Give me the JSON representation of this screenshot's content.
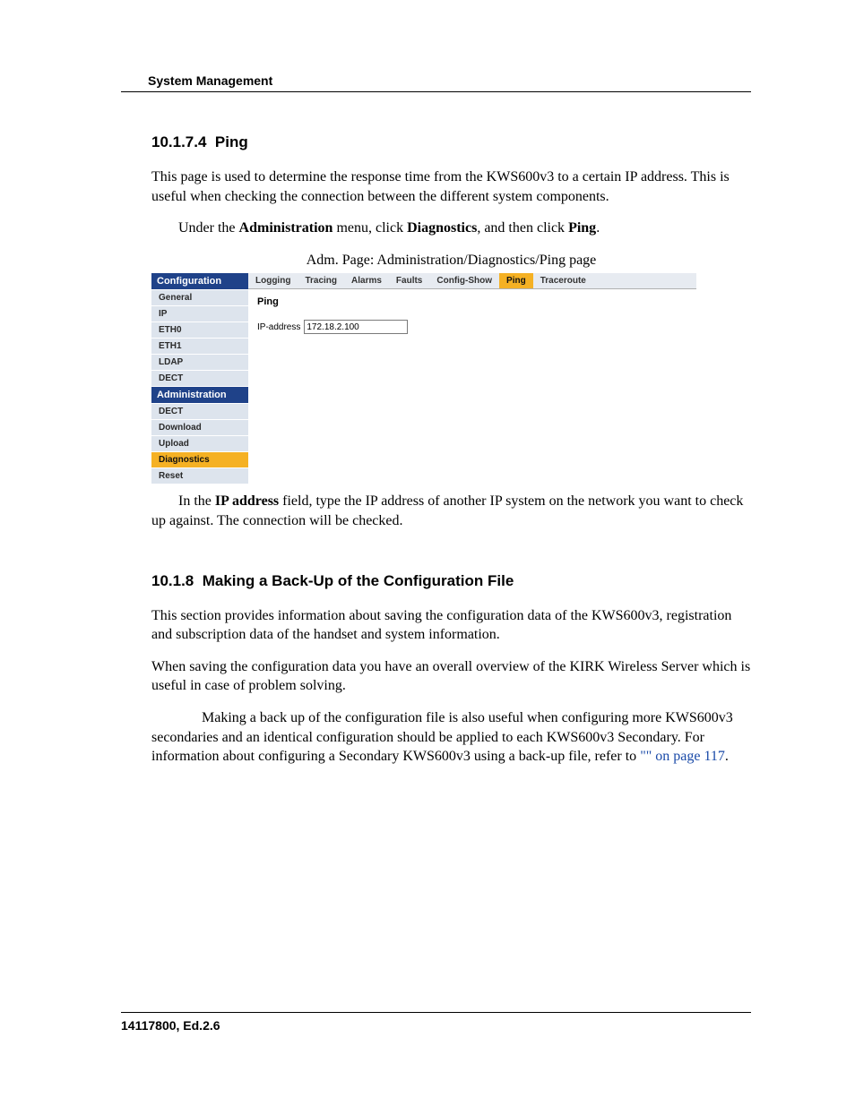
{
  "header": "System Management",
  "section1": {
    "number": "10.1.7.4",
    "title": "Ping",
    "para1": "This page is used to determine the response time from the KWS600v3 to a certain IP address. This is useful when checking the connection between the different system components.",
    "para2_pre": "Under the ",
    "para2_b1": "Administration",
    "para2_mid1": " menu, click ",
    "para2_b2": "Diagnostics",
    "para2_mid2": ", and then click ",
    "para2_b3": "Ping",
    "para2_post": ".",
    "caption": "Adm. Page: Administration/Diagnostics/Ping page",
    "para3_pre": "In the ",
    "para3_b1": "IP address",
    "para3_post": " field, type the IP address of another IP system on the network you want to check up against. The connection will be checked."
  },
  "admin": {
    "sidebar": {
      "section1": "Configuration",
      "items1": [
        "General",
        "IP",
        "ETH0",
        "ETH1",
        "LDAP",
        "DECT"
      ],
      "section2": "Administration",
      "items2": [
        "DECT",
        "Download",
        "Upload",
        "Diagnostics",
        "Reset"
      ],
      "active2_index": 3
    },
    "tabs": [
      "Logging",
      "Tracing",
      "Alarms",
      "Faults",
      "Config-Show",
      "Ping",
      "Traceroute"
    ],
    "active_tab_index": 5,
    "content_title": "Ping",
    "ip_label": "IP-address",
    "ip_value": "172.18.2.100"
  },
  "section2": {
    "number": "10.1.8",
    "title": "Making a Back-Up of the Configuration File",
    "para1": "This section provides information about saving the configuration data of the KWS600v3, registration and subscription data of the handset and system information.",
    "para2": "When saving the configuration data you have an overall overview of the KIRK Wireless Server which is useful in case of problem solving.",
    "para3_pre": "Making a back up of the configuration file is also useful when configuring more KWS600v3 secondaries and an identical configuration should be applied to each KWS600v3 Secondary. For information about configuring a Secondary KWS600v3 using a back-up file, refer to ",
    "para3_link": "\"\" on page 117",
    "para3_post": "."
  },
  "footer": "14117800, Ed.2.6"
}
